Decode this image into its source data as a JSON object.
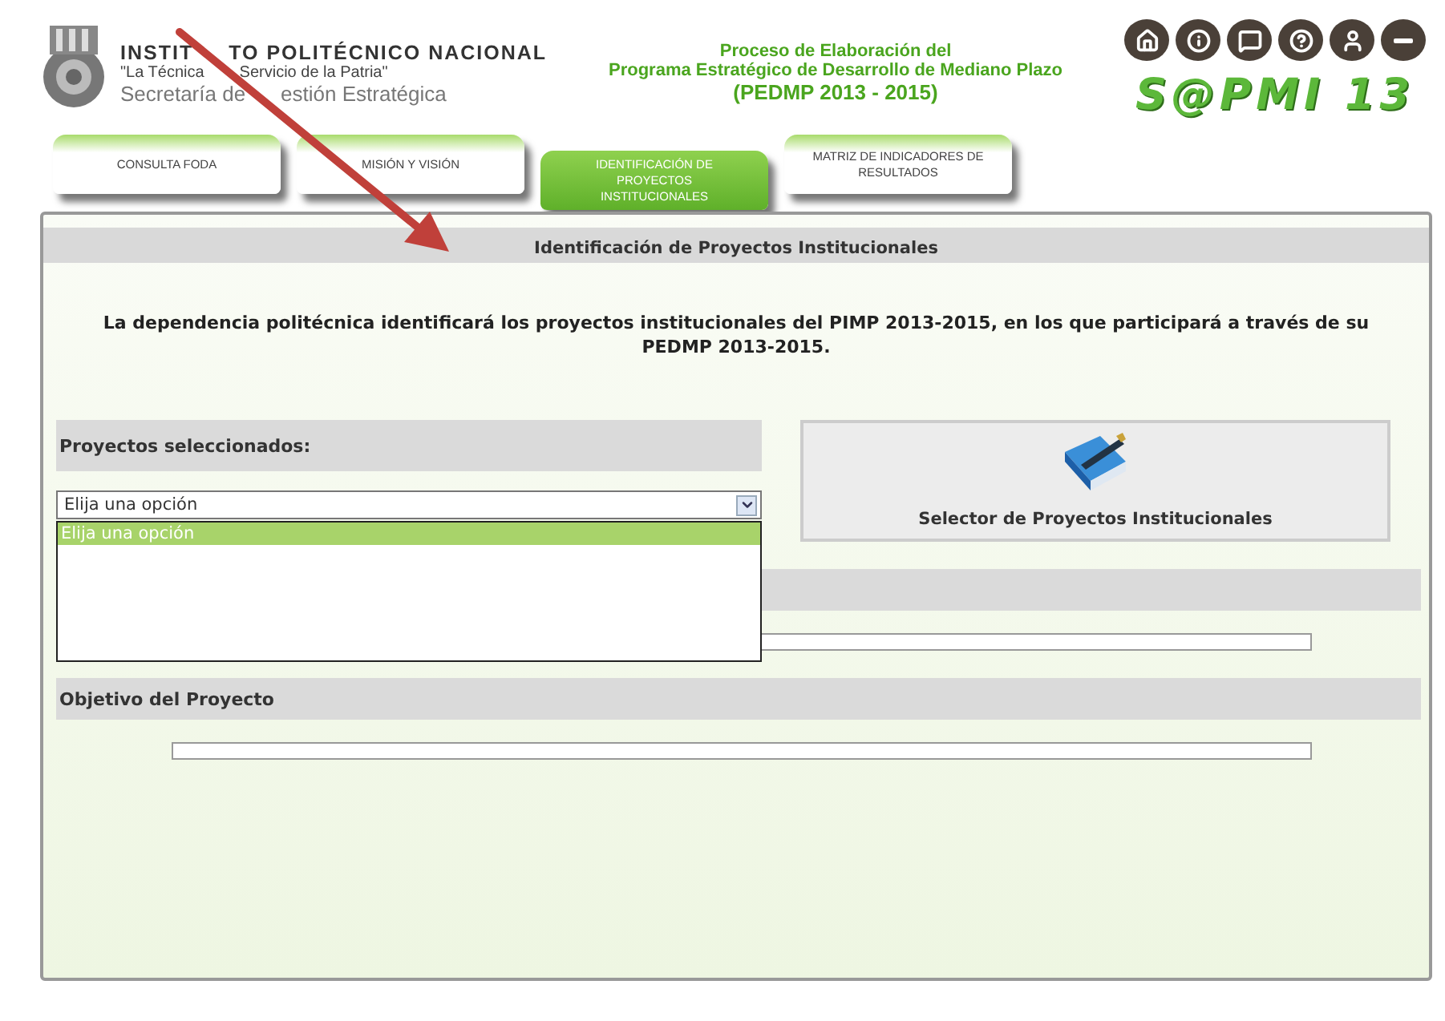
{
  "header": {
    "institution": [
      "INSTIT",
      "TO POLITÉCNICO NACIONAL"
    ],
    "motto": [
      "\"La Técnica",
      "Servicio de la Patria\""
    ],
    "office": [
      "Secretaría de",
      "estión Estratégica"
    ],
    "process_title": [
      "Proceso de Elaboración del",
      "Programa Estratégico de Desarrollo de Mediano Plazo",
      "(PEDMP 2013 - 2015)"
    ],
    "app_name": "S@PMI 13"
  },
  "toolbar": [
    {
      "kind": "home"
    },
    {
      "kind": "info"
    },
    {
      "kind": "comment"
    },
    {
      "kind": "help"
    },
    {
      "kind": "user"
    },
    {
      "kind": "minimize"
    }
  ],
  "tabs": [
    {
      "label": "CONSULTA FODA",
      "selected": false
    },
    {
      "label": "MISIÓN Y VISIÓN",
      "selected": false
    },
    {
      "label": "IDENTIFICACIÓN DE PROYECTOS INSTITUCIONALES",
      "selected": true
    },
    {
      "label": "MATRIZ DE INDICADORES DE RESULTADOS",
      "selected": false
    }
  ],
  "panel": {
    "title": "Identificación de Proyectos Institucionales",
    "intro": "La dependencia politécnica identificará los proyectos institucionales del PIMP 2013-2015, en los que participará a través de su PEDMP 2013-2015.",
    "selected_projects": {
      "label": "Proyectos seleccionados:",
      "value": "Elija una opción",
      "expanded": true,
      "options": [
        {
          "label": "Elija una opción",
          "selected": true
        }
      ]
    },
    "selector_button": "Selector de Proyectos Institucionales",
    "sections": [
      {
        "kind": "field"
      },
      {
        "kind": "field",
        "label": "Objetivo del Proyecto"
      }
    ]
  }
}
